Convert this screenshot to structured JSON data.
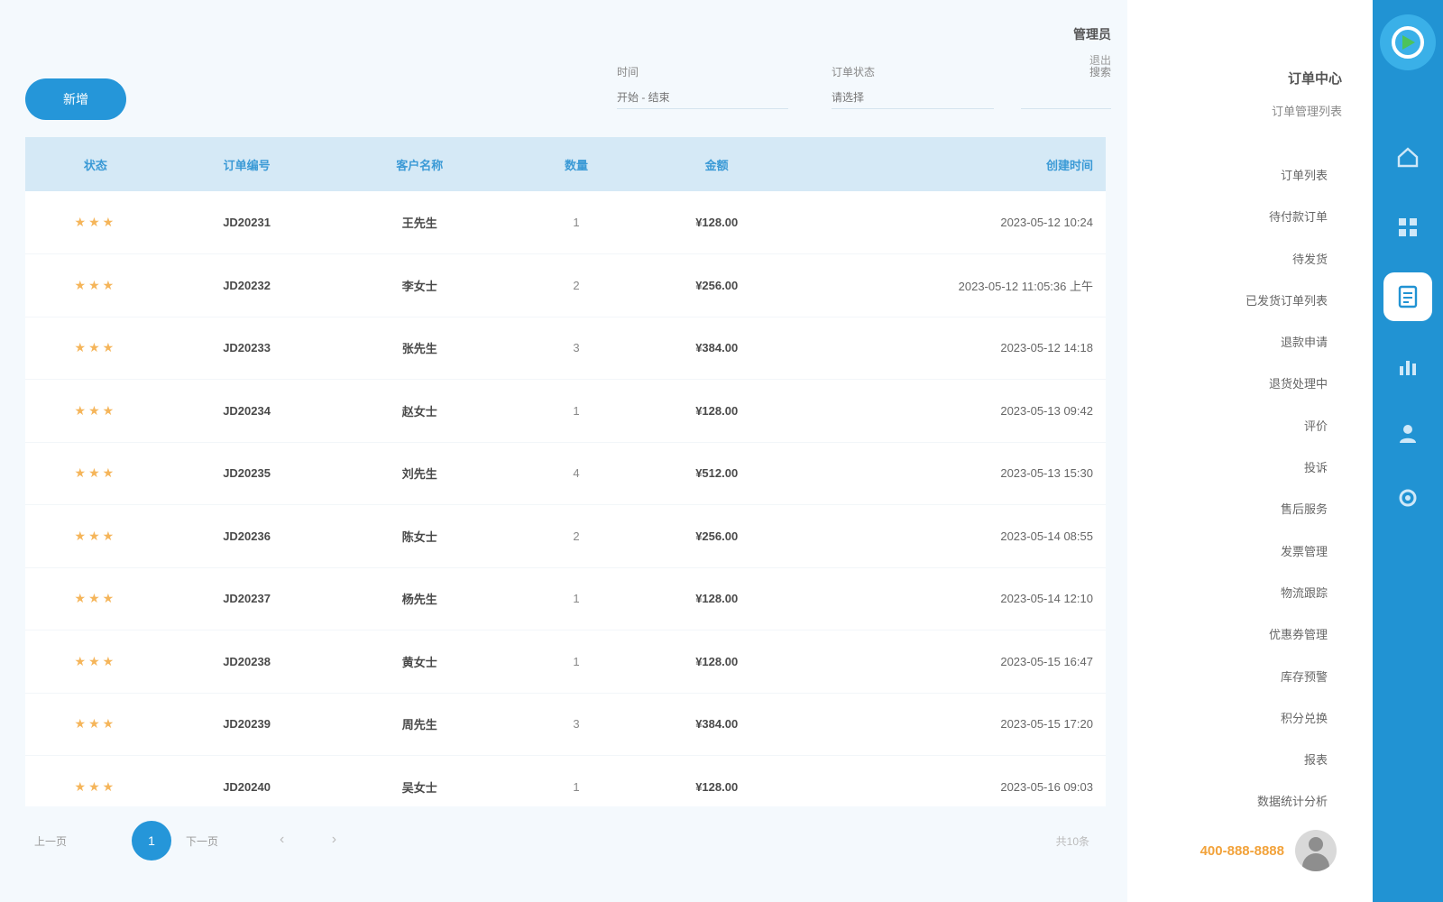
{
  "header": {
    "user_label": "管理员",
    "user_sub": "退出"
  },
  "toolbar": {
    "primary_button": "新增",
    "filter_1_label": "时间",
    "filter_1_placeholder": "开始 - 结束",
    "filter_2_label": "订单状态",
    "filter_2_placeholder": "请选择",
    "search_label": "搜索"
  },
  "table": {
    "columns": [
      "状态",
      "订单编号",
      "客户名称",
      "数量",
      "金额",
      "创建时间"
    ],
    "rows": [
      {
        "status": "★★★",
        "a": "JD20231",
        "b": "王先生",
        "c": "1",
        "d": "¥128.00",
        "e": "2023-05-12 10:24"
      },
      {
        "status": "★★★",
        "a": "JD20232",
        "b": "李女士",
        "c": "2",
        "d": "¥256.00",
        "e": "2023-05-12 11:05:36 上午"
      },
      {
        "status": "★★★",
        "a": "JD20233",
        "b": "张先生",
        "c": "3",
        "d": "¥384.00",
        "e": "2023-05-12 14:18"
      },
      {
        "status": "★★★",
        "a": "JD20234",
        "b": "赵女士",
        "c": "1",
        "d": "¥128.00",
        "e": "2023-05-13 09:42"
      },
      {
        "status": "★★★",
        "a": "JD20235",
        "b": "刘先生",
        "c": "4",
        "d": "¥512.00",
        "e": "2023-05-13 15:30"
      },
      {
        "status": "★★★",
        "a": "JD20236",
        "b": "陈女士",
        "c": "2",
        "d": "¥256.00",
        "e": "2023-05-14 08:55"
      },
      {
        "status": "★★★",
        "a": "JD20237",
        "b": "杨先生",
        "c": "1",
        "d": "¥128.00",
        "e": "2023-05-14 12:10"
      },
      {
        "status": "★★★",
        "a": "JD20238",
        "b": "黄女士",
        "c": "1",
        "d": "¥128.00",
        "e": "2023-05-15 16:47"
      },
      {
        "status": "★★★",
        "a": "JD20239",
        "b": "周先生",
        "c": "3",
        "d": "¥384.00",
        "e": "2023-05-15 17:20"
      },
      {
        "status": "★★★",
        "a": "JD20240",
        "b": "吴女士",
        "c": "1",
        "d": "¥128.00",
        "e": "2023-05-16 09:03"
      }
    ]
  },
  "pager": {
    "prev_label": "上一页",
    "current_page": "1",
    "next_label": "下一页",
    "arrows": "‹ ›",
    "total_label": "共10条"
  },
  "subnav": {
    "title": "订单中心",
    "subtitle": "订单管理列表",
    "items": [
      "订单列表",
      "待付款订单",
      "待发货",
      "已发货订单列表",
      "退款申请",
      "退货处理中",
      "评价",
      "投诉",
      "售后服务",
      "发票管理",
      "物流跟踪",
      "优惠券管理",
      "库存预警",
      "积分兑换",
      "报表",
      "数据统计分析"
    ],
    "phone": "400-888-8888"
  },
  "rail": {
    "logo_icon": "logo-icon",
    "icons": [
      "home-icon",
      "grid-icon",
      "document-icon",
      "chart-icon",
      "user-icon",
      "settings-icon"
    ]
  },
  "colors": {
    "accent": "#2596d9",
    "rail": "#2193d3",
    "header_row": "#d5e9f6",
    "stars": "#f5b55a",
    "phone": "#f2a23a"
  }
}
